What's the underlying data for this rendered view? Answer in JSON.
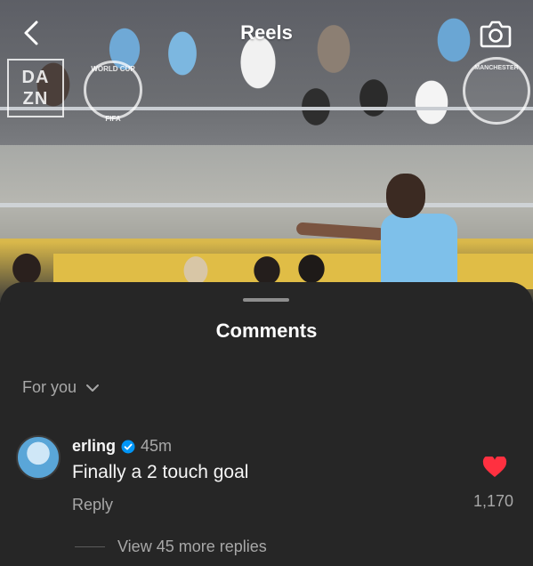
{
  "header": {
    "title": "Reels",
    "back_icon": "chevron-left-icon",
    "camera_icon": "camera-icon"
  },
  "watermarks": {
    "dazn_line1": "DA",
    "dazn_line2": "ZN",
    "world_cup": "WORLD CUP",
    "fifa": "FIFA",
    "city": "MANCHESTER"
  },
  "sheet": {
    "title": "Comments",
    "filter_label": "For you"
  },
  "comment": {
    "username": "erling",
    "verified": true,
    "time": "45m",
    "text": "Finally a 2 touch goal",
    "reply_label": "Reply",
    "like_count": "1,170",
    "liked": true,
    "view_replies_label": "View 45 more replies"
  },
  "colors": {
    "sheet_background": "#262626",
    "text_primary": "#f5f5f5",
    "text_secondary": "#a8a8a8",
    "verified_blue": "#0095f6",
    "like_red": "#ff3040"
  }
}
